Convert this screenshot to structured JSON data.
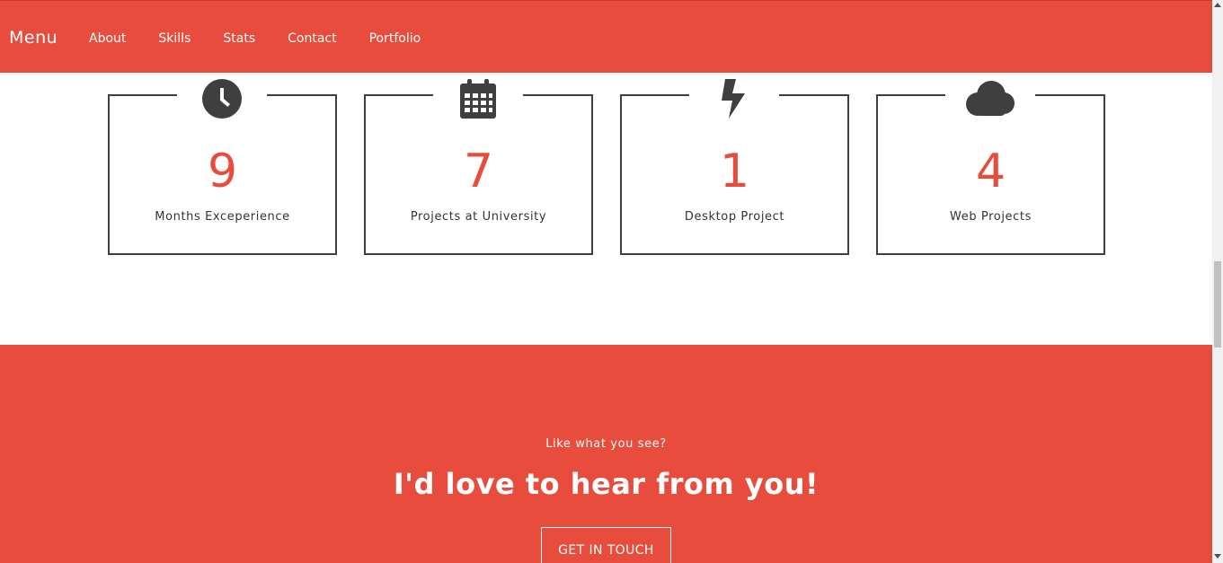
{
  "nav": {
    "brand": "Menu",
    "links": [
      "About",
      "Skills",
      "Stats",
      "Contact",
      "Portfolio"
    ]
  },
  "stats": [
    {
      "icon": "clock-icon",
      "number": "9",
      "label": "Months Exceperience"
    },
    {
      "icon": "calendar-icon",
      "number": "7",
      "label": "Projects at University"
    },
    {
      "icon": "lightning-icon",
      "number": "1",
      "label": "Desktop Project"
    },
    {
      "icon": "cloud-icon",
      "number": "4",
      "label": "Web Projects"
    }
  ],
  "cta": {
    "kicker": "Like what you see?",
    "title": "I'd love to hear from you!",
    "button": "GET IN TOUCH"
  },
  "colors": {
    "accent": "#e74c3c",
    "icon": "#3f3f3f",
    "text_dark": "#333333",
    "white": "#ffffff"
  }
}
